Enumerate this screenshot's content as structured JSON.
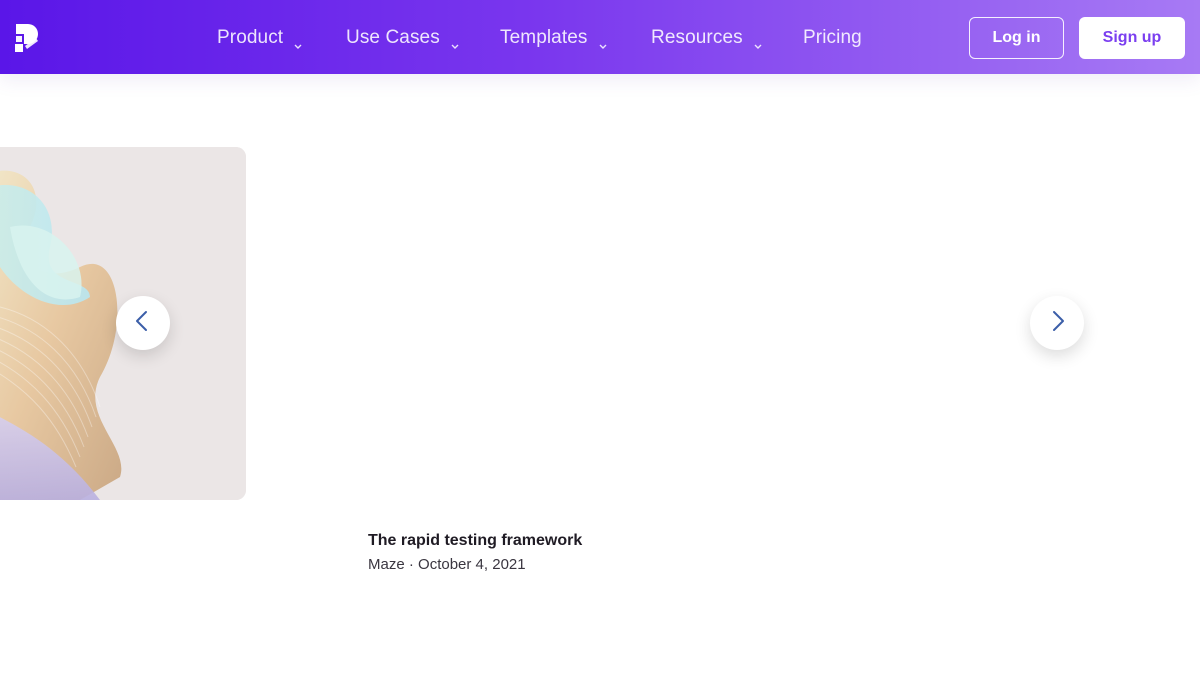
{
  "header": {
    "nav": [
      {
        "label": "Product",
        "has_dropdown": true
      },
      {
        "label": "Use Cases",
        "has_dropdown": true
      },
      {
        "label": "Templates",
        "has_dropdown": true
      },
      {
        "label": "Resources",
        "has_dropdown": true
      },
      {
        "label": "Pricing",
        "has_dropdown": false
      }
    ],
    "login_label": "Log in",
    "signup_label": "Sign up",
    "gradient_colors": [
      "#5a16e8",
      "#a77af4"
    ]
  },
  "carousel": {
    "prev_icon": "chevron-left-icon",
    "next_icon": "chevron-right-icon",
    "arrow_color": "#3b5ea8"
  },
  "article": {
    "title": "The rapid testing framework",
    "author": "Maze",
    "separator": "·",
    "date": "October 4, 2021"
  }
}
